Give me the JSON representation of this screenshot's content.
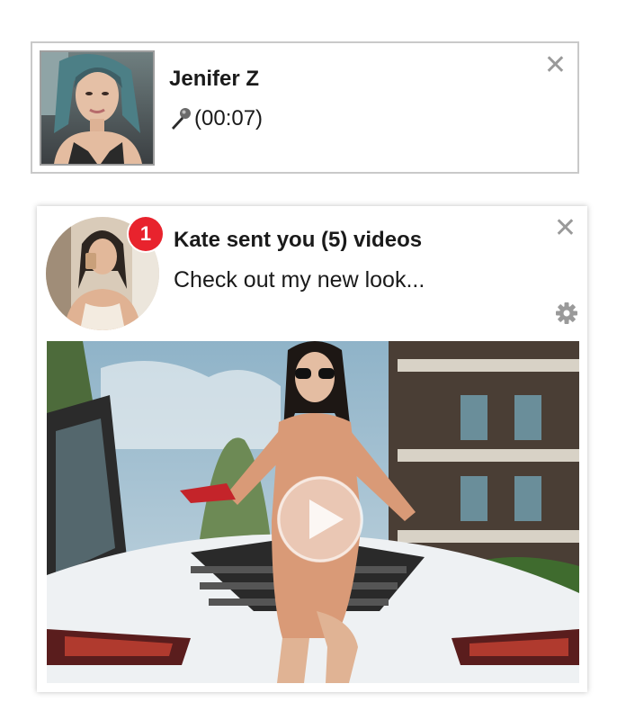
{
  "notification_1": {
    "sender_name": "Jenifer Z",
    "voice_duration": "(00:07)",
    "mic_icon": "microphone-icon",
    "close_icon": "close-icon",
    "close_glyph": "✕"
  },
  "notification_2": {
    "badge_count": "1",
    "title": "Kate sent you (5) videos",
    "message": "Check out my new look...",
    "close_icon": "close-icon",
    "close_glyph": "✕",
    "settings_icon": "gear-icon",
    "play_icon": "play-icon",
    "badge_color": "#e8232d"
  }
}
